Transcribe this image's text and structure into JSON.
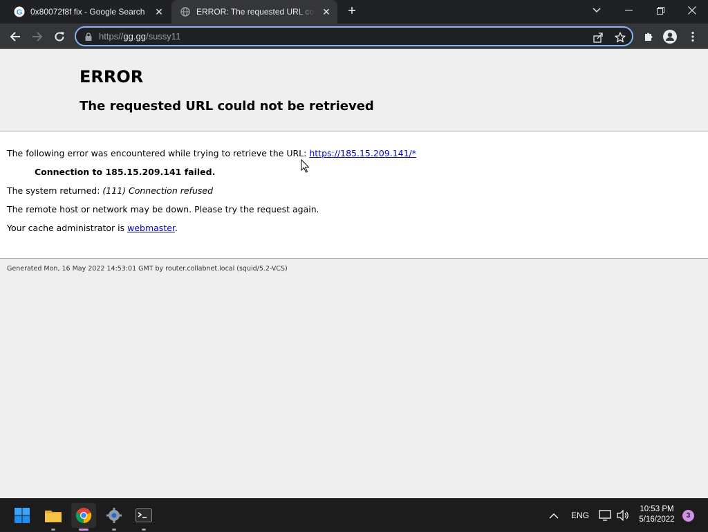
{
  "browser": {
    "tabs": [
      {
        "title": "0x80072f8f fix - Google Search",
        "favicon": "google-icon",
        "active": false
      },
      {
        "title": "ERROR: The requested URL could not be retrieved",
        "favicon": "globe-icon",
        "active": true
      }
    ],
    "new_tab_label": "+",
    "address_bar": {
      "scheme": "https",
      "separator": "//",
      "domain": "gg.gg",
      "path": "/sussy11"
    }
  },
  "page": {
    "heading": "ERROR",
    "subheading": "The requested URL could not be retrieved",
    "line1_prefix": "The following error was encountered while trying to retrieve the URL: ",
    "line1_link": "https://185.15.209.141/*",
    "line2": "Connection to 185.15.209.141 failed.",
    "line3_prefix": "The system returned: ",
    "line3_value": "(111) Connection refused",
    "line4": "The remote host or network may be down. Please try the request again.",
    "line5_prefix": "Your cache administrator is ",
    "line5_link": "webmaster",
    "line5_suffix": ".",
    "generated": "Generated Mon, 16 May 2022 14:53:01 GMT by router.collabnet.local (squid/5.2-VCS)"
  },
  "taskbar": {
    "apps": [
      "windows-start-icon",
      "file-explorer-icon",
      "chrome-icon",
      "settings-icon",
      "terminal-icon"
    ],
    "language": "ENG",
    "time": "10:53 PM",
    "date": "5/16/2022",
    "notification_count": "3"
  },
  "colors": {
    "accent": "#8ab4f8",
    "link": "#0000cc",
    "notification": "#d092e8"
  }
}
